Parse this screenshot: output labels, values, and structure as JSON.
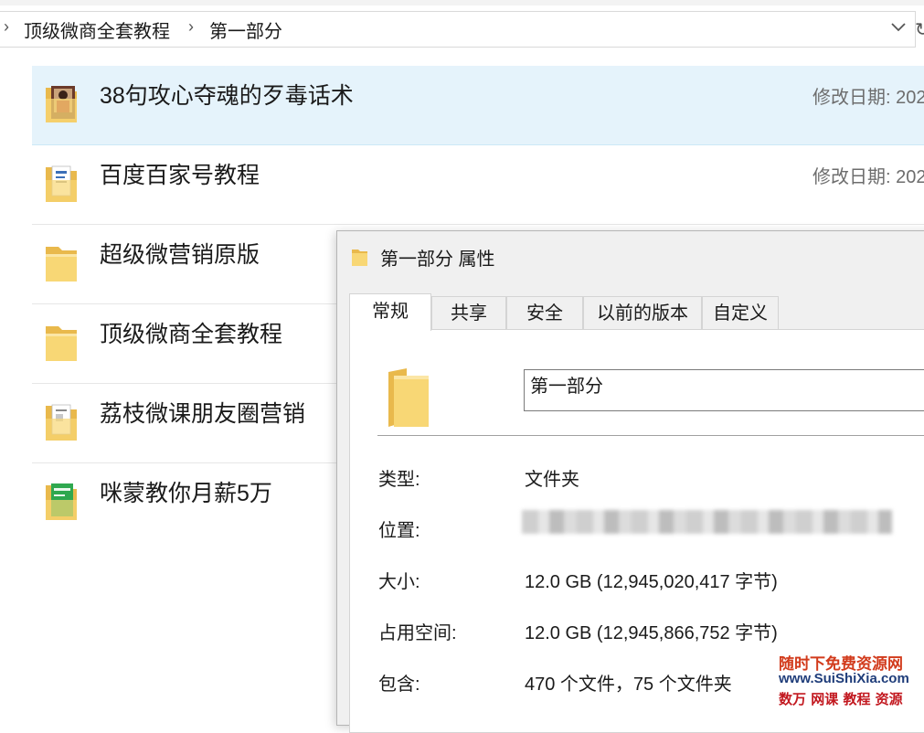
{
  "addressbar": {
    "crumbs": [
      "顶级微商全套教程",
      "第一部分"
    ]
  },
  "files": [
    {
      "name": "38句攻心夺魂的歹毒话术",
      "meta": "修改日期: 202",
      "icon": "folder-photo-icon",
      "selected": true
    },
    {
      "name": "百度百家号教程",
      "meta": "修改日期: 202",
      "icon": "folder-docs-icon",
      "selected": false
    },
    {
      "name": "超级微营销原版",
      "meta": "",
      "icon": "folder-icon",
      "selected": false
    },
    {
      "name": "顶级微商全套教程",
      "meta": "",
      "icon": "folder-icon",
      "selected": false
    },
    {
      "name": "荔枝微课朋友圈营销",
      "meta": "",
      "icon": "folder-docs-icon",
      "selected": false
    },
    {
      "name": "咪蒙教你月薪5万",
      "meta": "",
      "icon": "folder-green-icon",
      "selected": false
    }
  ],
  "dialog": {
    "title": "第一部分 属性",
    "tabs": [
      "常规",
      "共享",
      "安全",
      "以前的版本",
      "自定义"
    ],
    "active_tab": "常规",
    "folder_name": "第一部分",
    "props": {
      "type_label": "类型:",
      "type_value": "文件夹",
      "location_label": "位置:",
      "size_label": "大小:",
      "size_value": "12.0 GB (12,945,020,417 字节)",
      "disk_label": "占用空间:",
      "disk_value": "12.0 GB (12,945,866,752 字节)",
      "contains_label": "包含:",
      "contains_value": "470 个文件，75 个文件夹"
    }
  },
  "watermark": {
    "line1": "随时下免费资源网",
    "line2": "www.SuiShiXia.com",
    "line3": "数万 网课 教程 资源"
  },
  "colors": {
    "selection": "#e5f3fb",
    "folder_yellow": "#f8d775",
    "dialog_bg": "#f0f0f0"
  }
}
